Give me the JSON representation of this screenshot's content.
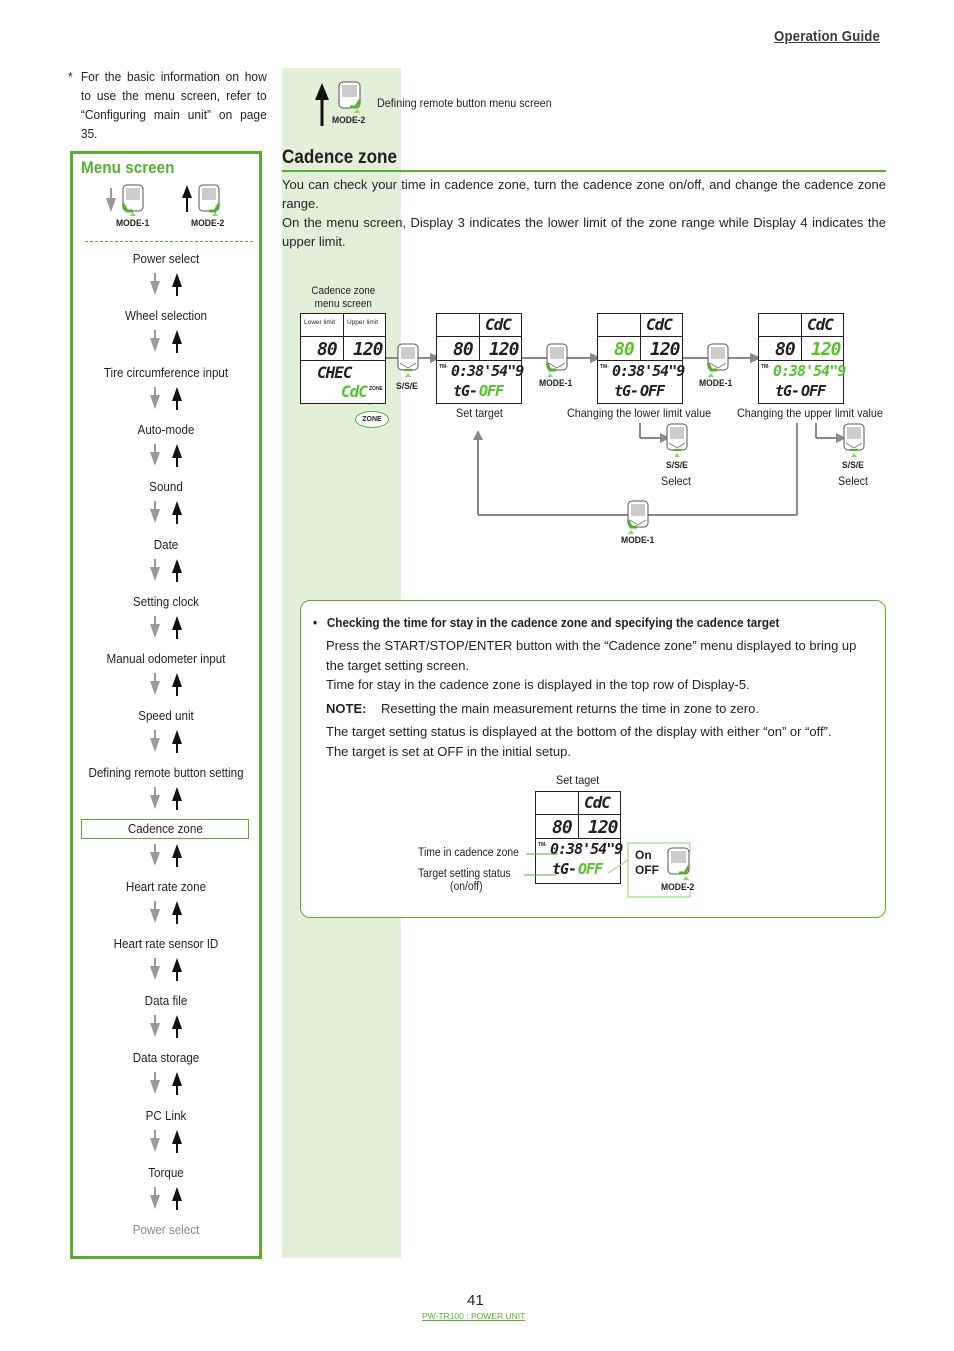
{
  "header": {
    "title": "Operation Guide"
  },
  "footnote": {
    "marker": "*",
    "text": "For the basic information on how to use the menu screen, refer to “Configuring main unit” on page 35."
  },
  "menu_panel": {
    "title": "Menu screen",
    "legend": [
      {
        "button": "MODE-1",
        "direction": "down"
      },
      {
        "button": "MODE-2",
        "direction": "up"
      }
    ],
    "items": [
      {
        "label": "Power select",
        "state": "normal"
      },
      {
        "label": "Wheel selection",
        "state": "normal"
      },
      {
        "label": "Tire circumference input",
        "state": "normal"
      },
      {
        "label": "Auto-mode",
        "state": "normal"
      },
      {
        "label": "Sound",
        "state": "normal"
      },
      {
        "label": "Date",
        "state": "normal"
      },
      {
        "label": "Setting clock",
        "state": "normal"
      },
      {
        "label": "Manual odometer input",
        "state": "normal"
      },
      {
        "label": "Speed unit",
        "state": "normal"
      },
      {
        "label": "Defining remote button setting",
        "state": "normal"
      },
      {
        "label": "Cadence zone",
        "state": "active"
      },
      {
        "label": "Heart rate zone",
        "state": "normal"
      },
      {
        "label": "Heart rate sensor ID",
        "state": "normal"
      },
      {
        "label": "Data file",
        "state": "normal"
      },
      {
        "label": "Data storage",
        "state": "normal"
      },
      {
        "label": "PC Link",
        "state": "normal"
      },
      {
        "label": "Torque",
        "state": "normal"
      },
      {
        "label": "Power select",
        "state": "dim"
      }
    ]
  },
  "top_nav": {
    "button": "MODE-2",
    "text": "Defining remote button menu screen"
  },
  "section": {
    "title": "Cadence zone",
    "intro": [
      "You can check your time in cadence zone, turn the cadence zone on/off, and change the cadence zone range.",
      "On the menu screen, Display 3 indicates the lower limit of the zone range while Display 4 indicates the upper limit."
    ]
  },
  "flow": {
    "menu_screen": {
      "caption": "Cadence zone menu screen",
      "lower_label": "Lower limit",
      "upper_label": "Upper limit",
      "lower_value": "80",
      "upper_value": "120",
      "line1": "CHEC",
      "line2": "CdC",
      "zone_tag": "ZONE",
      "zone_badge": "ZONE"
    },
    "buttons": {
      "sse": "S/S/E",
      "mode1": "MODE-1",
      "mode2": "MODE-2"
    },
    "screens": [
      {
        "caption": "Set target",
        "top": "CdC",
        "lower": "80",
        "upper": "120",
        "time": "0:38'54\"9",
        "status": "tG-OFF",
        "highlight": "status"
      },
      {
        "caption": "Changing the lower limit value",
        "top": "CdC",
        "lower": "80",
        "upper": "120",
        "time": "0:38'54\"9",
        "status": "tG-OFF",
        "highlight": "lower"
      },
      {
        "caption": "Changing the upper limit value",
        "top": "CdC",
        "lower": "80",
        "upper": "120",
        "time": "0:38'54\"9",
        "status": "tG-OFF",
        "highlight": "upper"
      }
    ],
    "select_label": "Select",
    "tm_label": "TM-",
    "status_prefix": "tG-",
    "status_value": "OFF"
  },
  "note_box": {
    "heading": "Checking the time for stay in the cadence zone and specifying the cadence target",
    "paragraphs": [
      "Press the START/STOP/ENTER button with the “Cadence zone” menu displayed to bring up the target setting screen.",
      "Time for stay in the cadence zone is displayed in the top row of Display-5."
    ],
    "note_label": "NOTE:",
    "note_text": "Resetting the main measurement returns the time in zone to zero.",
    "paragraphs2": [
      "The target setting status is displayed at the bottom of the display with either “on” or “off”.",
      "The target is set at OFF in the initial setup."
    ],
    "diagram": {
      "caption": "Set taget",
      "time_label": "Time in cadence zone",
      "status_label": "Target setting status",
      "status_sub": "(on/off)",
      "on": "On",
      "off": "OFF",
      "button": "MODE-2"
    }
  },
  "footer": {
    "page": "41",
    "product": "PW-TR100 : POWER UNIT"
  },
  "colors": {
    "accent": "#5aad32",
    "lcd_highlight": "#57c22e",
    "panel_bg": "#e2f0d8"
  }
}
